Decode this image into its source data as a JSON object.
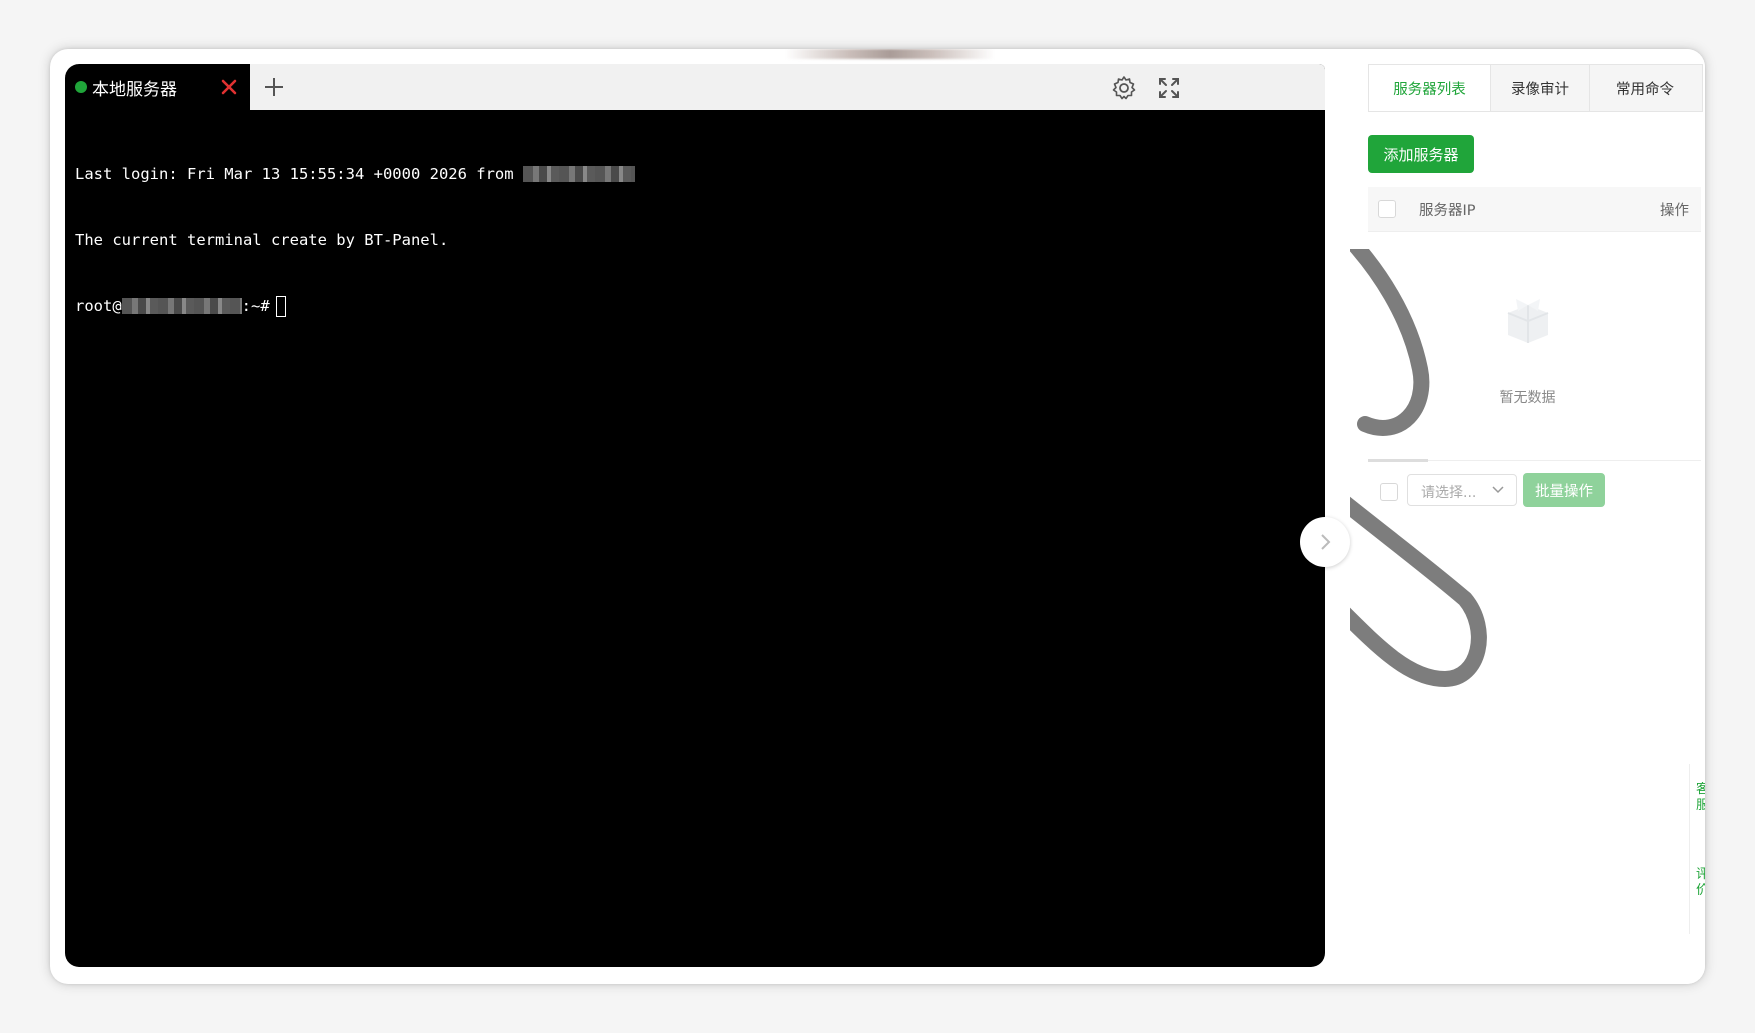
{
  "terminal": {
    "tab_label": "本地服务器",
    "status_color": "#20a53a",
    "close_icon_color": "#e03131",
    "line1_prefix": "Last login: Fri Mar 13 15:55:34 +0000 2026 from ",
    "line2": "The current terminal create by BT-Panel.",
    "prompt_user": "root@",
    "prompt_suffix": ":~#"
  },
  "icons": {
    "add_tab": "plus-icon",
    "settings": "gear-icon",
    "fullscreen": "fullscreen-icon",
    "collapse": "chevron-right-icon"
  },
  "right_panel": {
    "tabs": [
      {
        "label": "服务器列表"
      },
      {
        "label": "录像审计"
      },
      {
        "label": "常用命令"
      }
    ],
    "add_server_button": "添加服务器",
    "table": {
      "col_ip": "服务器IP",
      "col_action": "操作"
    },
    "empty_text": "暂无数据",
    "select_placeholder": "请选择...",
    "batch_button": "批量操作"
  },
  "side_widget": {
    "item1": "客服",
    "item2": "评价"
  },
  "colors": {
    "accent": "#20a53a",
    "accent_disabled": "#8fd29b",
    "terminal_bg": "#000000"
  }
}
